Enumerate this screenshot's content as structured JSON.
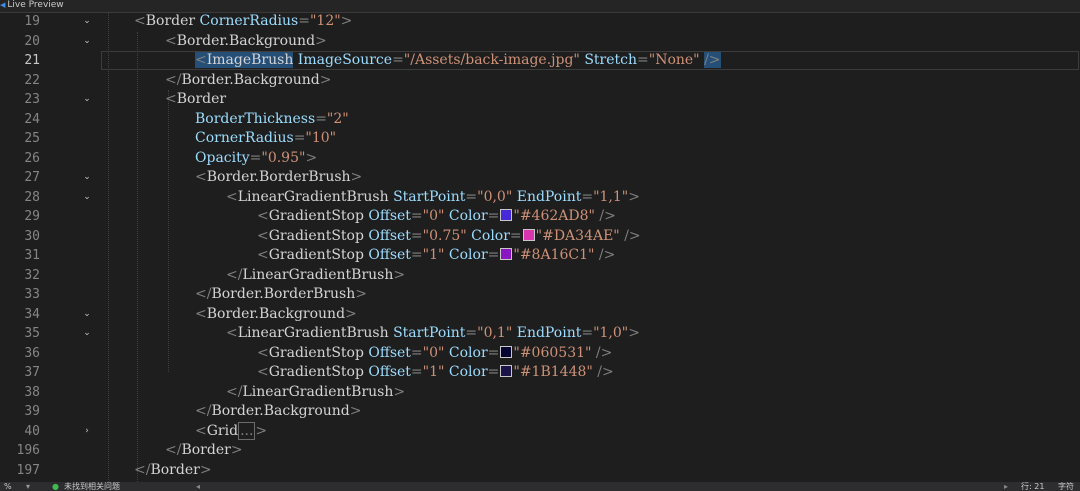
{
  "topbar": {
    "live_preview": "Live Preview"
  },
  "status": {
    "zoom": "%",
    "issues": "未找到相关问题",
    "line": "行: 21",
    "chars": "字符"
  },
  "lines": [
    {
      "n": "19",
      "fold": "v",
      "indent": 1,
      "tokens": [
        [
          "p",
          "<"
        ],
        [
          "t",
          "Border"
        ],
        [
          "s",
          " "
        ],
        [
          "a",
          "CornerRadius"
        ],
        [
          "p",
          "="
        ],
        [
          "v",
          "\"12\""
        ],
        [
          "p",
          ">"
        ]
      ]
    },
    {
      "n": "20",
      "fold": "v",
      "indent": 2,
      "tokens": [
        [
          "p",
          "<"
        ],
        [
          "t",
          "Border.Background"
        ],
        [
          "p",
          ">"
        ]
      ]
    },
    {
      "n": "21",
      "fold": "",
      "indent": 3,
      "current": true,
      "tokens": [
        [
          "ph",
          "<"
        ],
        [
          "th",
          "ImageBrush"
        ],
        [
          "s",
          " "
        ],
        [
          "a",
          "ImageSource"
        ],
        [
          "p",
          "="
        ],
        [
          "v",
          "\"/Assets/back-image.jpg\""
        ],
        [
          "s",
          " "
        ],
        [
          "a",
          "Stretch"
        ],
        [
          "p",
          "="
        ],
        [
          "v",
          "\"None\""
        ],
        [
          "s",
          " "
        ],
        [
          "ph",
          "/>"
        ]
      ]
    },
    {
      "n": "22",
      "fold": "",
      "indent": 2,
      "tokens": [
        [
          "p",
          "</"
        ],
        [
          "t",
          "Border.Background"
        ],
        [
          "p",
          ">"
        ]
      ]
    },
    {
      "n": "23",
      "fold": "v",
      "indent": 2,
      "tokens": [
        [
          "p",
          "<"
        ],
        [
          "t",
          "Border"
        ]
      ]
    },
    {
      "n": "24",
      "fold": "",
      "indent": 3,
      "tokens": [
        [
          "a",
          "BorderThickness"
        ],
        [
          "p",
          "="
        ],
        [
          "v",
          "\"2\""
        ]
      ]
    },
    {
      "n": "25",
      "fold": "",
      "indent": 3,
      "tokens": [
        [
          "a",
          "CornerRadius"
        ],
        [
          "p",
          "="
        ],
        [
          "v",
          "\"10\""
        ]
      ]
    },
    {
      "n": "26",
      "fold": "",
      "indent": 3,
      "tokens": [
        [
          "a",
          "Opacity"
        ],
        [
          "p",
          "="
        ],
        [
          "v",
          "\"0.95\""
        ],
        [
          "p",
          ">"
        ]
      ]
    },
    {
      "n": "27",
      "fold": "v",
      "indent": 3,
      "tokens": [
        [
          "p",
          "<"
        ],
        [
          "t",
          "Border.BorderBrush"
        ],
        [
          "p",
          ">"
        ]
      ]
    },
    {
      "n": "28",
      "fold": "v",
      "indent": 4,
      "tokens": [
        [
          "p",
          "<"
        ],
        [
          "t",
          "LinearGradientBrush"
        ],
        [
          "s",
          " "
        ],
        [
          "a",
          "StartPoint"
        ],
        [
          "p",
          "="
        ],
        [
          "v",
          "\"0,0\""
        ],
        [
          "s",
          " "
        ],
        [
          "a",
          "EndPoint"
        ],
        [
          "p",
          "="
        ],
        [
          "v",
          "\"1,1\""
        ],
        [
          "p",
          ">"
        ]
      ]
    },
    {
      "n": "29",
      "fold": "",
      "indent": 5,
      "tokens": [
        [
          "p",
          "<"
        ],
        [
          "t",
          "GradientStop"
        ],
        [
          "s",
          " "
        ],
        [
          "a",
          "Offset"
        ],
        [
          "p",
          "="
        ],
        [
          "v",
          "\"0\""
        ],
        [
          "s",
          " "
        ],
        [
          "a",
          "Color"
        ],
        [
          "p",
          "="
        ],
        [
          "c",
          "#462AD8"
        ],
        [
          "v",
          "\"#462AD8\""
        ],
        [
          "s",
          " "
        ],
        [
          "p",
          "/>"
        ]
      ]
    },
    {
      "n": "30",
      "fold": "",
      "indent": 5,
      "tokens": [
        [
          "p",
          "<"
        ],
        [
          "t",
          "GradientStop"
        ],
        [
          "s",
          " "
        ],
        [
          "a",
          "Offset"
        ],
        [
          "p",
          "="
        ],
        [
          "v",
          "\"0.75\""
        ],
        [
          "s",
          " "
        ],
        [
          "a",
          "Color"
        ],
        [
          "p",
          "="
        ],
        [
          "c",
          "#DA34AE"
        ],
        [
          "v",
          "\"#DA34AE\""
        ],
        [
          "s",
          " "
        ],
        [
          "p",
          "/>"
        ]
      ]
    },
    {
      "n": "31",
      "fold": "",
      "indent": 5,
      "tokens": [
        [
          "p",
          "<"
        ],
        [
          "t",
          "GradientStop"
        ],
        [
          "s",
          " "
        ],
        [
          "a",
          "Offset"
        ],
        [
          "p",
          "="
        ],
        [
          "v",
          "\"1\""
        ],
        [
          "s",
          " "
        ],
        [
          "a",
          "Color"
        ],
        [
          "p",
          "="
        ],
        [
          "c",
          "#8A16C1"
        ],
        [
          "v",
          "\"#8A16C1\""
        ],
        [
          "s",
          " "
        ],
        [
          "p",
          "/>"
        ]
      ]
    },
    {
      "n": "32",
      "fold": "",
      "indent": 4,
      "tokens": [
        [
          "p",
          "</"
        ],
        [
          "t",
          "LinearGradientBrush"
        ],
        [
          "p",
          ">"
        ]
      ]
    },
    {
      "n": "33",
      "fold": "",
      "indent": 3,
      "tokens": [
        [
          "p",
          "</"
        ],
        [
          "t",
          "Border.BorderBrush"
        ],
        [
          "p",
          ">"
        ]
      ]
    },
    {
      "n": "34",
      "fold": "v",
      "indent": 3,
      "tokens": [
        [
          "p",
          "<"
        ],
        [
          "t",
          "Border.Background"
        ],
        [
          "p",
          ">"
        ]
      ]
    },
    {
      "n": "35",
      "fold": "v",
      "indent": 4,
      "tokens": [
        [
          "p",
          "<"
        ],
        [
          "t",
          "LinearGradientBrush"
        ],
        [
          "s",
          " "
        ],
        [
          "a",
          "StartPoint"
        ],
        [
          "p",
          "="
        ],
        [
          "v",
          "\"0,1\""
        ],
        [
          "s",
          " "
        ],
        [
          "a",
          "EndPoint"
        ],
        [
          "p",
          "="
        ],
        [
          "v",
          "\"1,0\""
        ],
        [
          "p",
          ">"
        ]
      ]
    },
    {
      "n": "36",
      "fold": "",
      "indent": 5,
      "tokens": [
        [
          "p",
          "<"
        ],
        [
          "t",
          "GradientStop"
        ],
        [
          "s",
          " "
        ],
        [
          "a",
          "Offset"
        ],
        [
          "p",
          "="
        ],
        [
          "v",
          "\"0\""
        ],
        [
          "s",
          " "
        ],
        [
          "a",
          "Color"
        ],
        [
          "p",
          "="
        ],
        [
          "c",
          "#060531"
        ],
        [
          "v",
          "\"#060531\""
        ],
        [
          "s",
          " "
        ],
        [
          "p",
          "/>"
        ]
      ]
    },
    {
      "n": "37",
      "fold": "",
      "indent": 5,
      "tokens": [
        [
          "p",
          "<"
        ],
        [
          "t",
          "GradientStop"
        ],
        [
          "s",
          " "
        ],
        [
          "a",
          "Offset"
        ],
        [
          "p",
          "="
        ],
        [
          "v",
          "\"1\""
        ],
        [
          "s",
          " "
        ],
        [
          "a",
          "Color"
        ],
        [
          "p",
          "="
        ],
        [
          "c",
          "#1B1448"
        ],
        [
          "v",
          "\"#1B1448\""
        ],
        [
          "s",
          " "
        ],
        [
          "p",
          "/>"
        ]
      ]
    },
    {
      "n": "38",
      "fold": "",
      "indent": 4,
      "tokens": [
        [
          "p",
          "</"
        ],
        [
          "t",
          "LinearGradientBrush"
        ],
        [
          "p",
          ">"
        ]
      ]
    },
    {
      "n": "39",
      "fold": "",
      "indent": 3,
      "tokens": [
        [
          "p",
          "</"
        ],
        [
          "t",
          "Border.Background"
        ],
        [
          "p",
          ">"
        ]
      ]
    },
    {
      "n": "40",
      "fold": ">",
      "indent": 3,
      "tokens": [
        [
          "p",
          "<"
        ],
        [
          "t",
          "Grid"
        ],
        [
          "x",
          "..."
        ],
        [
          "p",
          ">"
        ]
      ]
    },
    {
      "n": "196",
      "fold": "",
      "indent": 2,
      "tokens": [
        [
          "p",
          "</"
        ],
        [
          "t",
          "Border"
        ],
        [
          "p",
          ">"
        ]
      ]
    },
    {
      "n": "197",
      "fold": "",
      "indent": 1,
      "tokens": [
        [
          "p",
          "</"
        ],
        [
          "t",
          "Border"
        ],
        [
          "p",
          ">"
        ]
      ]
    }
  ]
}
